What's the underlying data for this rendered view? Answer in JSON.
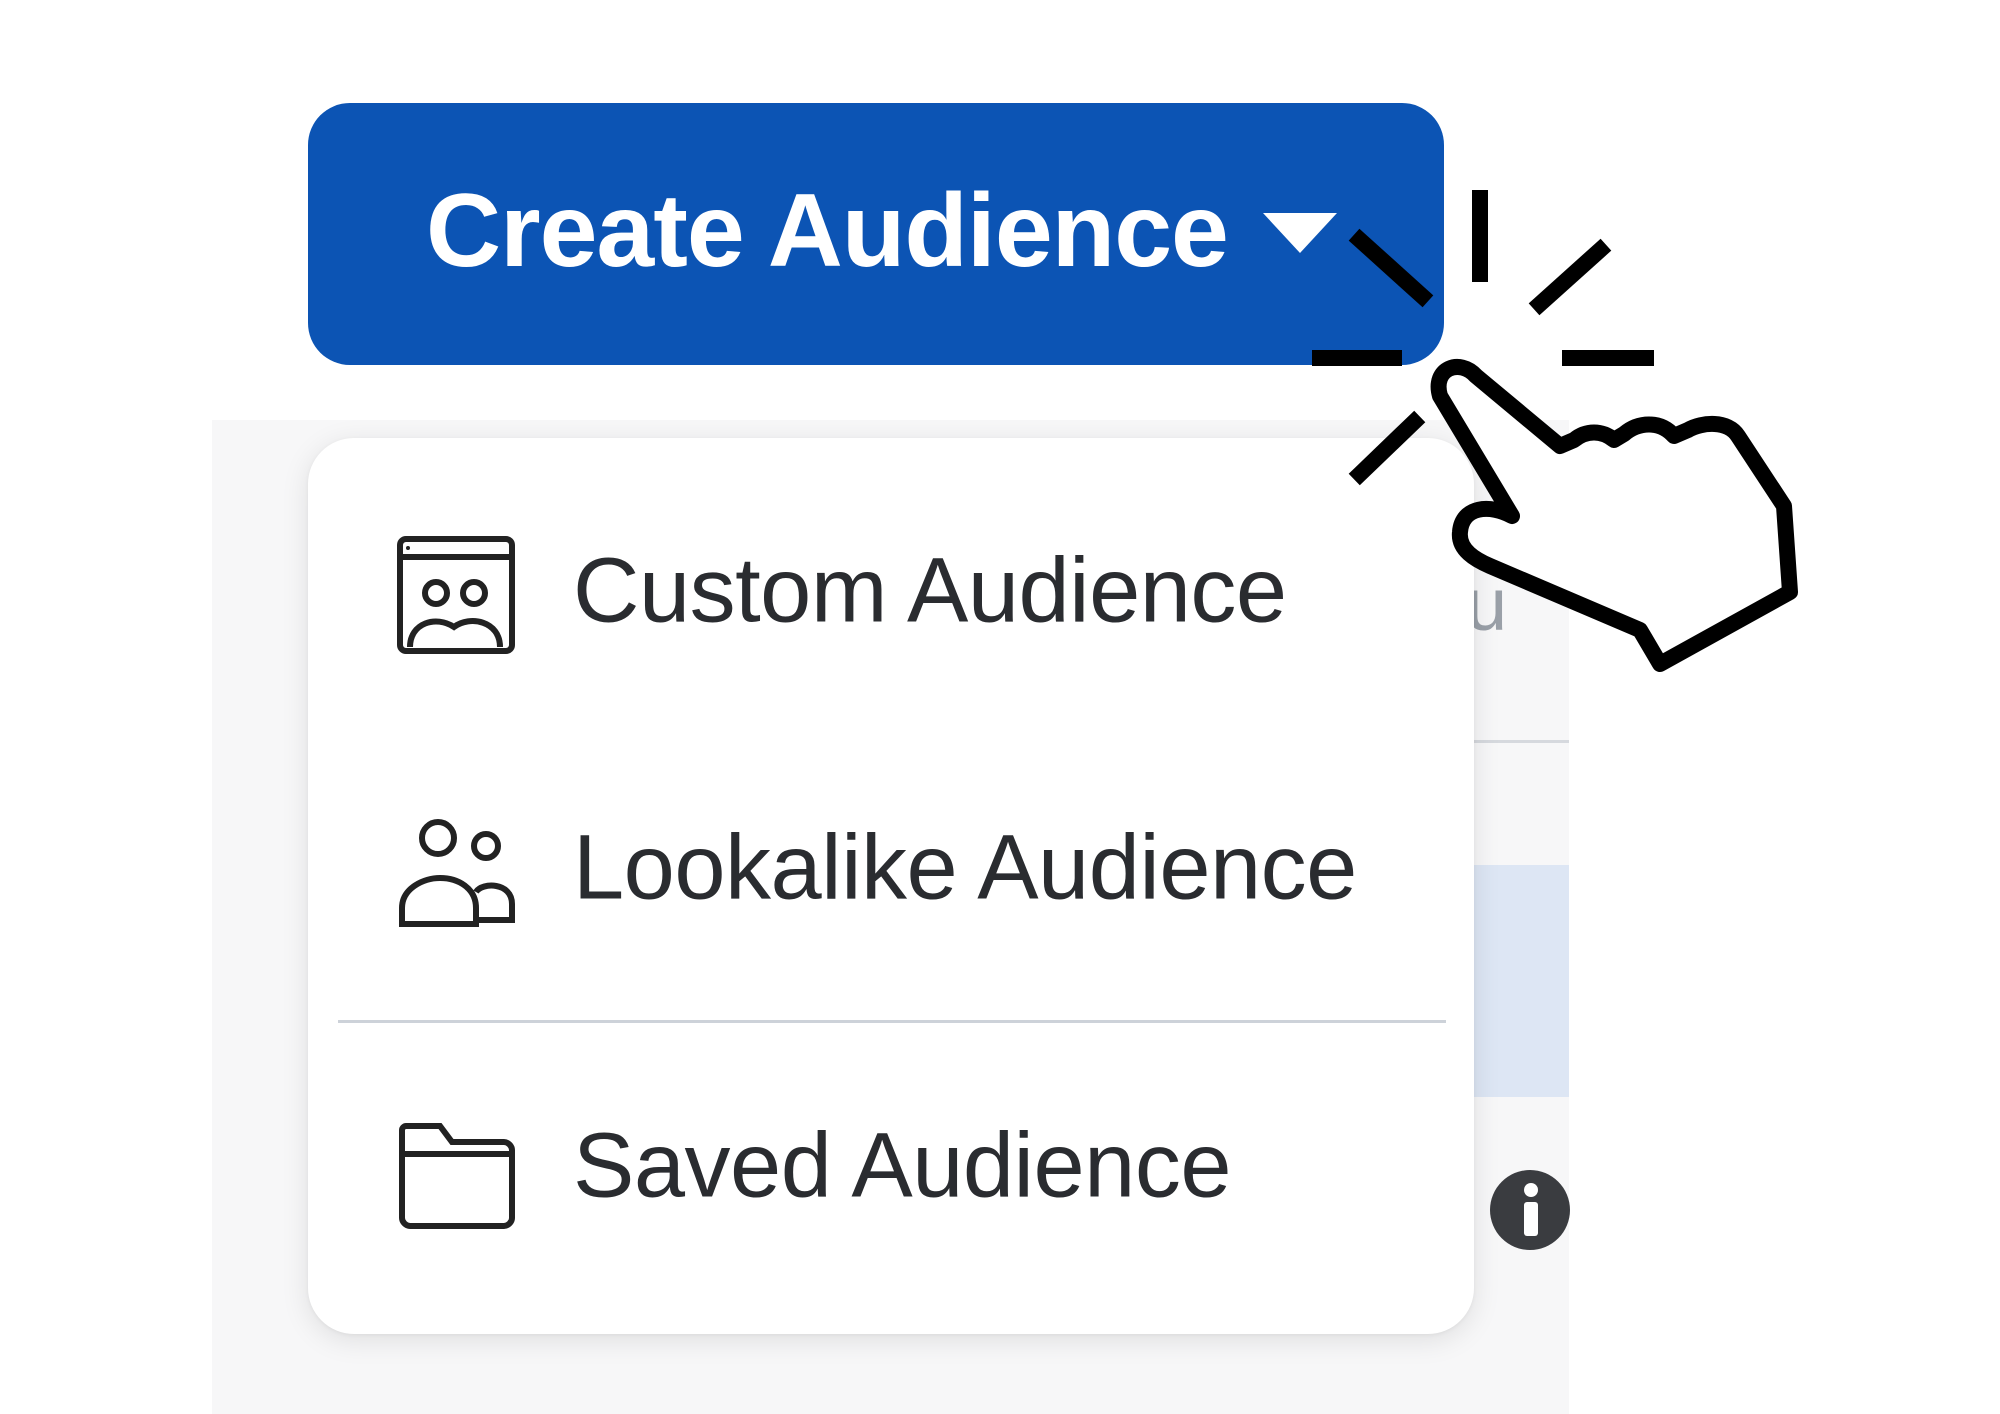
{
  "create_button": {
    "label": "Create Audience",
    "color": "#0c54b4"
  },
  "menu": {
    "items": [
      {
        "label": "Custom Audience",
        "icon": "custom-audience-icon"
      },
      {
        "label": "Lookalike Audience",
        "icon": "people-icon"
      },
      {
        "label": "Saved Audience",
        "icon": "folder-icon"
      }
    ]
  },
  "background": {
    "partial_text": "u"
  },
  "pointer": {
    "icon": "hand-pointer-icon"
  }
}
